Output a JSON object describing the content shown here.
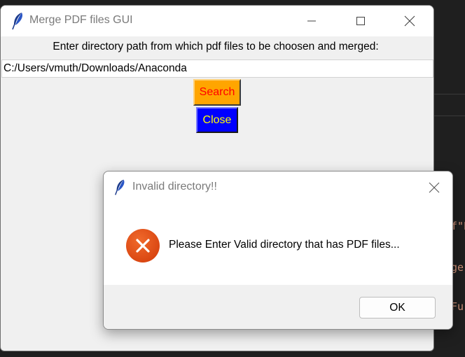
{
  "main_window": {
    "title": "Merge PDF files GUI",
    "prompt": "Enter directory path from which pdf files to be choosen and merged:",
    "path_value": "C:/Users/vmuth/Downloads/Anaconda",
    "search_label": "Search",
    "close_label": "Close",
    "icons": {
      "app": "feather-icon",
      "minimize": "minimize-icon",
      "maximize": "maximize-icon",
      "close": "close-icon"
    }
  },
  "dialog": {
    "title": "Invalid directory!!",
    "message": "Please Enter Valid directory that has PDF files...",
    "ok_label": "OK",
    "icons": {
      "app": "feather-icon",
      "close": "close-icon",
      "status": "error-icon"
    }
  },
  "background_editor": {
    "snippets": [
      "f\"P",
      "ge",
      "Fu"
    ]
  },
  "colors": {
    "search_bg": "#ffa500",
    "search_fg": "#ff0000",
    "close_bg": "#0000ff",
    "close_fg": "#ffff00",
    "error_red": "#e04e16"
  }
}
